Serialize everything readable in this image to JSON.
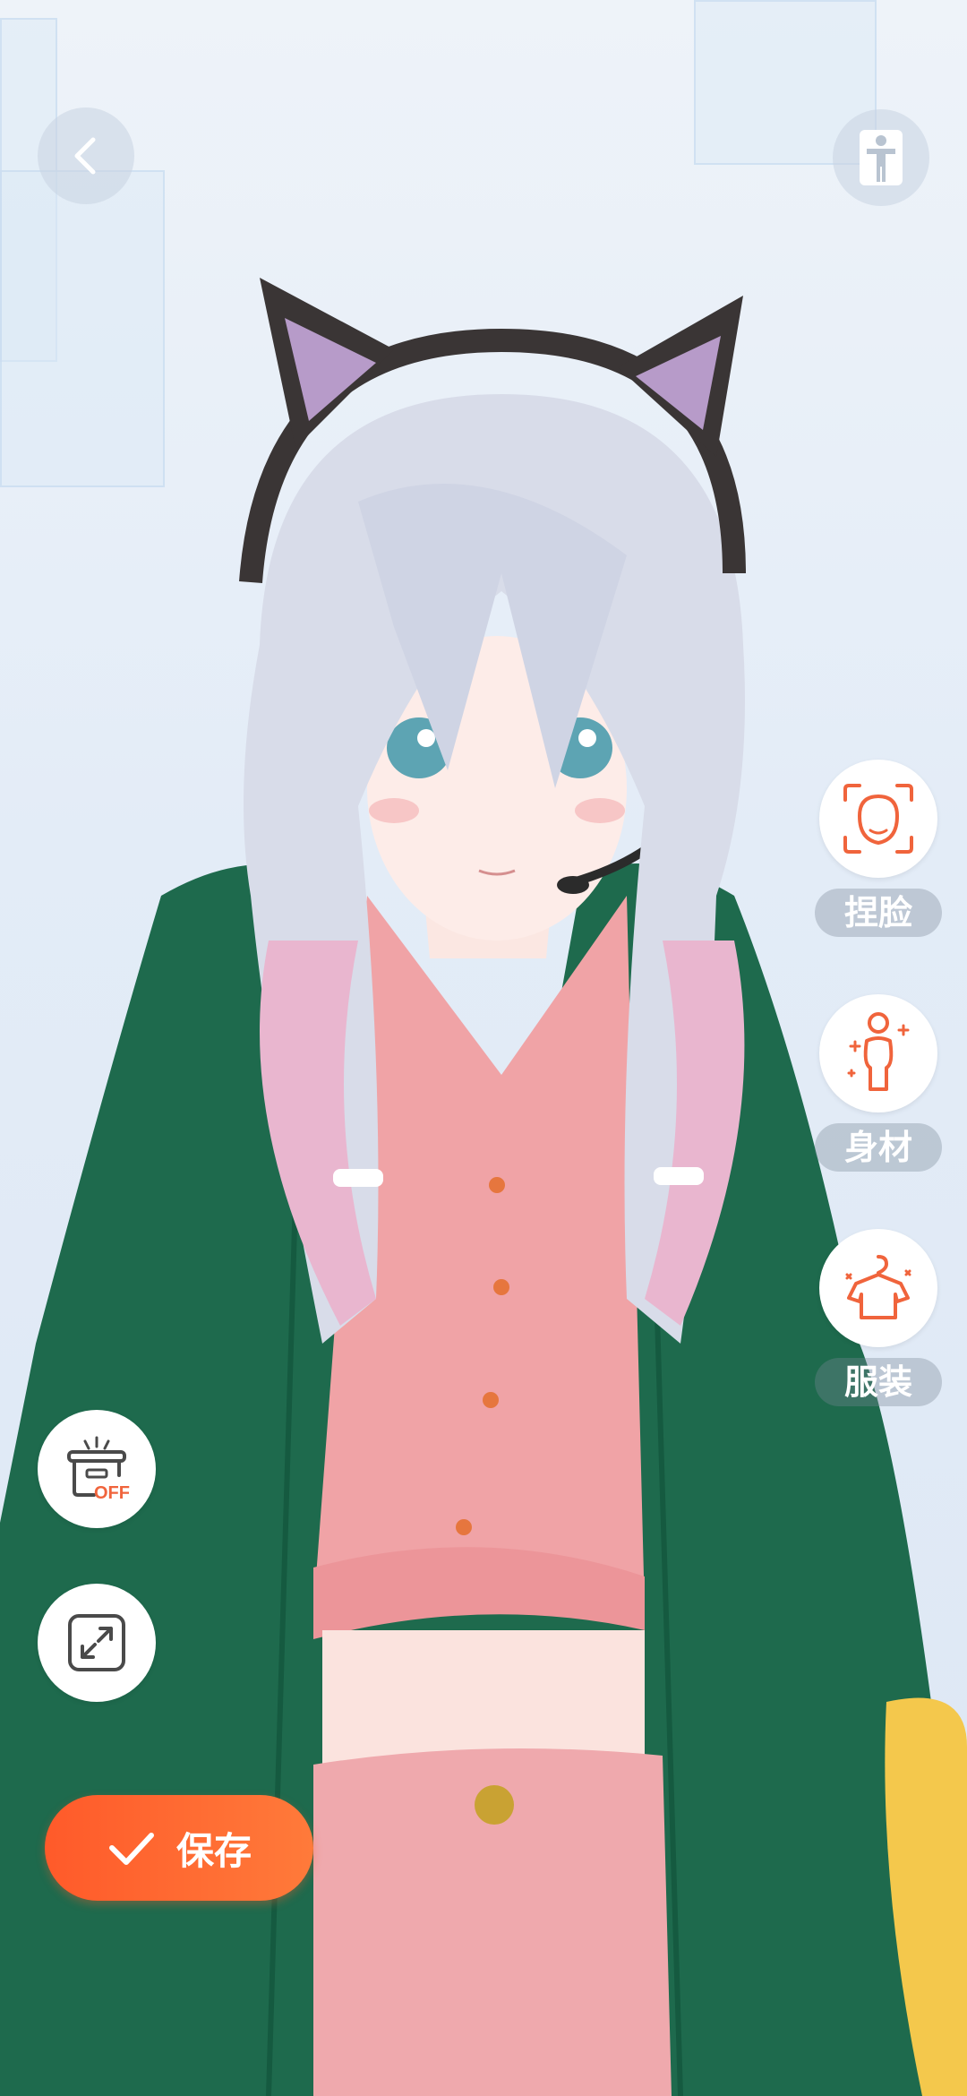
{
  "top_bar": {
    "back_icon": "chevron-left-icon",
    "pose_icon": "person-pose-icon"
  },
  "side_tools": [
    {
      "label": "捏脸",
      "icon": "face-edit-icon"
    },
    {
      "label": "身材",
      "icon": "body-edit-icon"
    },
    {
      "label": "服装",
      "icon": "clothing-icon"
    }
  ],
  "left_tools": [
    {
      "icon": "turntable-off-icon",
      "badge": "OFF"
    },
    {
      "icon": "expand-icon"
    }
  ],
  "save": {
    "label": "保存",
    "icon": "check-icon"
  },
  "colors": {
    "accent": "#ff5a2a",
    "icon_orange": "#f0643c",
    "label_bg": "#8a97a6"
  }
}
